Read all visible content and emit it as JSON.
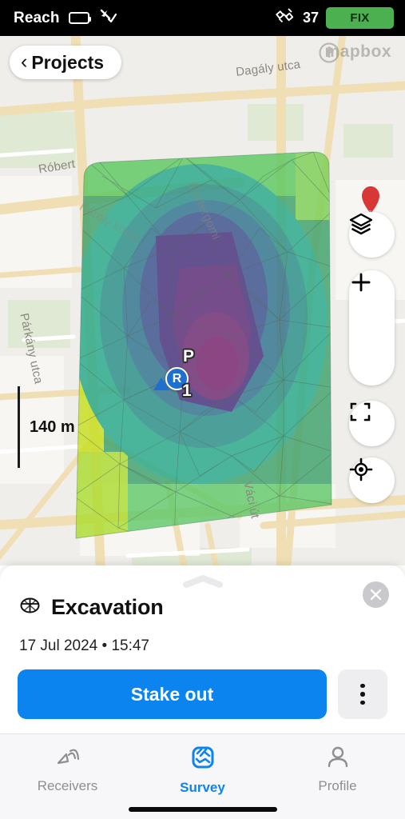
{
  "status_bar": {
    "device_name": "Reach",
    "battery_icon": "battery-icon",
    "signal_icon": "antenna-signal-icon",
    "satellite_icon": "satellite-icon",
    "satellite_count": "37",
    "fix_status": "FIX",
    "fix_color": "#4CAF50"
  },
  "map": {
    "back_button_label": "Projects",
    "back_chevron_icon": "chevron-left-icon",
    "attribution": {
      "logo_icon": "mapbox-logo-icon",
      "wordmark": "mapbox",
      "info_icon": "info-icon"
    },
    "controls": {
      "layers_icon": "layers-icon",
      "zoom_in_icon": "plus-icon",
      "zoom_out_icon": "minus-icon",
      "fit_bounds_icon": "fit-bounds-icon",
      "locate_icon": "locate-crosshair-icon"
    },
    "scale_bar": {
      "label": "140 m"
    },
    "markers": [
      {
        "name": "point-marker-p",
        "label": "P"
      },
      {
        "name": "base-station-marker",
        "label": "R"
      },
      {
        "name": "rover-position-arrow",
        "label": ""
      },
      {
        "name": "point-marker-1",
        "label": "1"
      }
    ],
    "street_labels": [
      "Dagály utca",
      "Róbert",
      "Párkány utca",
      "Váci út",
      "Esztergomi",
      "Károly körút"
    ],
    "surface_colors": {
      "low": "#f0e442",
      "mid_green": "#4bbf73",
      "mid_teal": "#2a9d8f",
      "high_blue": "#3b5a9d",
      "peak_purple": "#6a2f7a"
    }
  },
  "sheet": {
    "drag_handle_icon": "chevron-up-handle-icon",
    "close_icon": "close-icon",
    "surface_icon": "surface-mesh-icon",
    "title": "Excavation",
    "date": "17 Jul 2024 • 15:47",
    "primary_action": "Stake out",
    "primary_action_color": "#0b84ef",
    "more_icon": "more-vertical-icon"
  },
  "tab_bar": {
    "tabs": [
      {
        "label": "Receivers",
        "icon": "antenna-icon",
        "active": false
      },
      {
        "label": "Survey",
        "icon": "survey-map-icon",
        "active": true
      },
      {
        "label": "Profile",
        "icon": "person-icon",
        "active": false
      }
    ],
    "active_color": "#0b84ef",
    "inactive_color": "#8e8e93"
  }
}
